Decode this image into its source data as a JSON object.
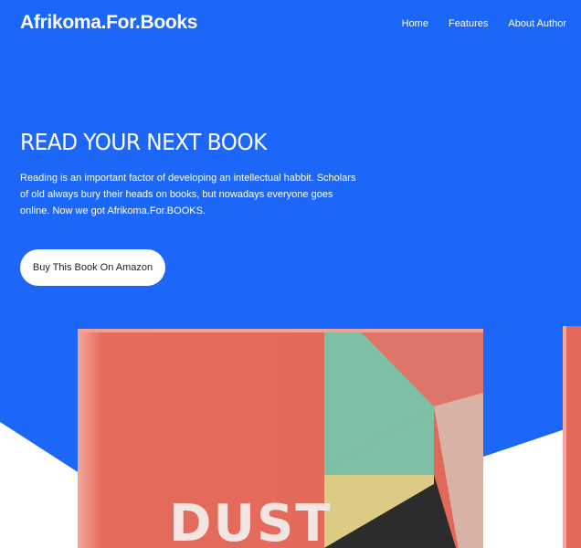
{
  "nav": {
    "brand": "Afrikoma.For.Books",
    "links": [
      "Home",
      "Features",
      "About Author"
    ]
  },
  "hero": {
    "headline": "READ YOUR NEXT BOOK",
    "lead": "Reading is an important factor of developing an intellectual habbit. Scholars of old always bury their heads on books, but nowadays everyone goes online. Now we got Afrikoma.For.BOOKS.",
    "cta_label": "Buy This Book On Amazon"
  },
  "book": {
    "cover_title": "DUST"
  },
  "colors": {
    "hero_blue": "#1d67f8",
    "cover_coral": "#e2685a",
    "cover_teal": "#7ec0a4",
    "cover_yellow": "#dccb85",
    "cover_dark": "#2c2c2c"
  }
}
